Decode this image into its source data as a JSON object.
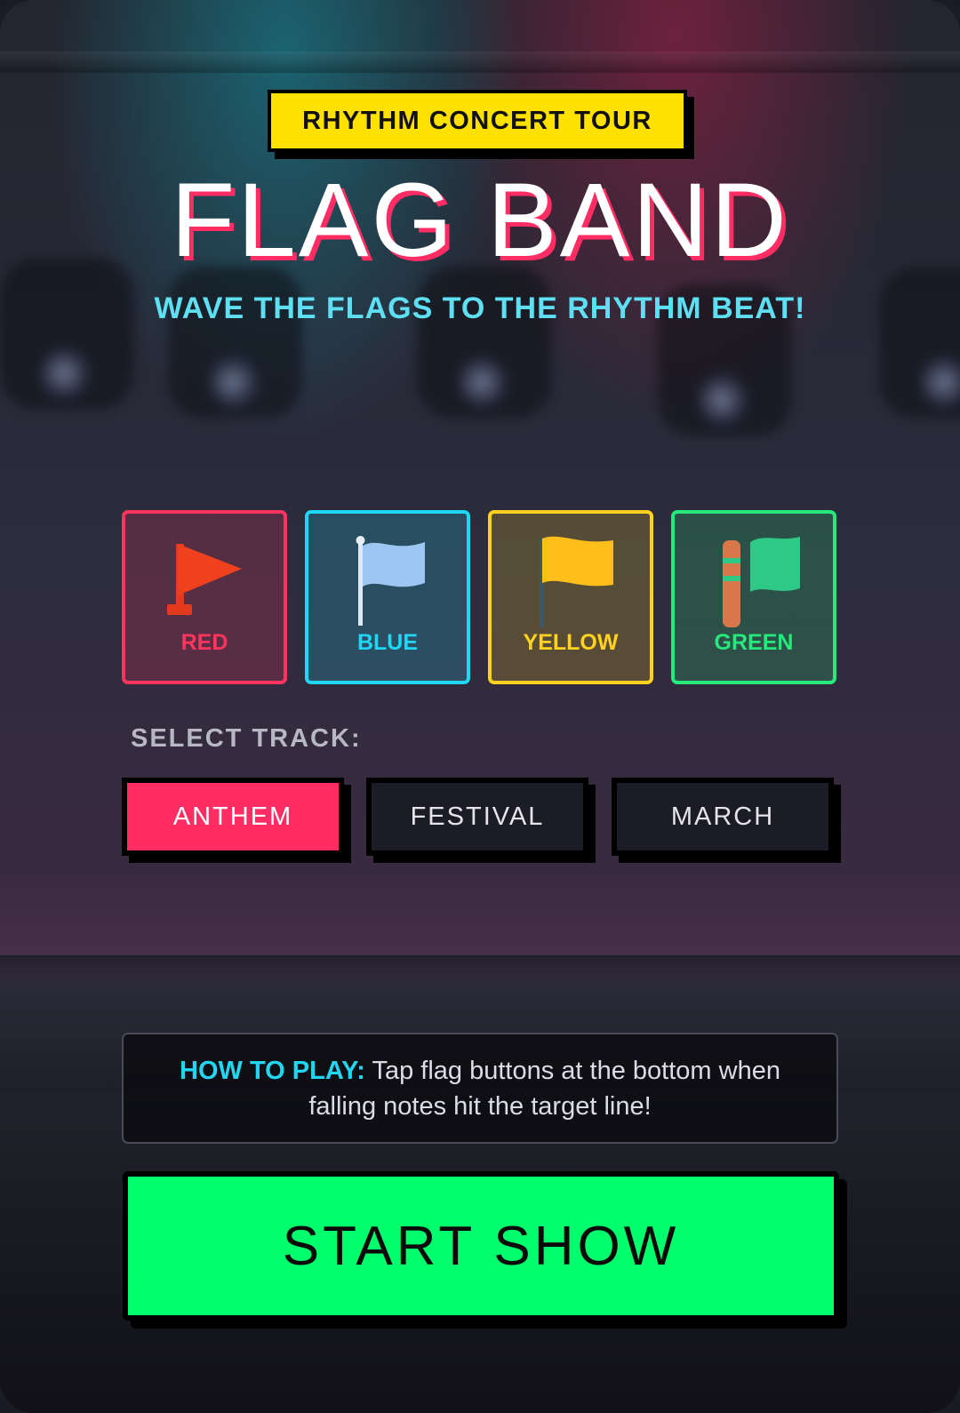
{
  "header": {
    "badge": "RHYTHM CONCERT TOUR",
    "title": "FLAG BAND",
    "subtitle": "WAVE THE FLAGS TO THE RHYTHM BEAT!"
  },
  "flags": [
    {
      "label": "RED",
      "icon": "red-flag-icon",
      "color": "#ff3560"
    },
    {
      "label": "BLUE",
      "icon": "blue-flag-icon",
      "color": "#1fd6f5"
    },
    {
      "label": "YELLOW",
      "icon": "yellow-flag-icon",
      "color": "#ffd21f"
    },
    {
      "label": "GREEN",
      "icon": "green-flag-icon",
      "color": "#27e87a"
    }
  ],
  "tracks": {
    "label": "SELECT TRACK:",
    "options": [
      "ANTHEM",
      "FESTIVAL",
      "MARCH"
    ],
    "selected": "ANTHEM"
  },
  "howto": {
    "lead": "HOW TO PLAY:",
    "text": " Tap flag buttons at the bottom when falling notes hit the target line!"
  },
  "start_label": "START SHOW"
}
